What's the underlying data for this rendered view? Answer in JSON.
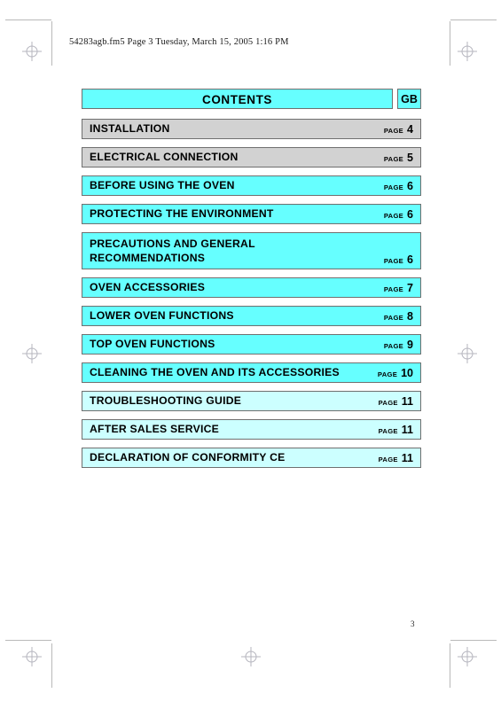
{
  "document": {
    "running_header": "54283agb.fm5  Page 3  Tuesday, March 15, 2005  1:16 PM",
    "folio": "3"
  },
  "contents": {
    "title": "CONTENTS",
    "language_code": "GB",
    "page_word": "PAGE",
    "rows": [
      {
        "label": "INSTALLATION",
        "page": "4",
        "fill": "fill-gray",
        "lines": 1
      },
      {
        "label": "ELECTRICAL CONNECTION",
        "page": "5",
        "fill": "fill-gray",
        "lines": 1
      },
      {
        "label": "BEFORE USING THE OVEN",
        "page": "6",
        "fill": "fill-cyan",
        "lines": 1
      },
      {
        "label": "PROTECTING THE ENVIRONMENT",
        "page": "6",
        "fill": "fill-cyan",
        "lines": 1
      },
      {
        "label": "PRECAUTIONS AND GENERAL\nRECOMMENDATIONS",
        "page": "6",
        "fill": "fill-cyan",
        "lines": 2
      },
      {
        "label": "OVEN ACCESSORIES",
        "page": "7",
        "fill": "fill-cyan",
        "lines": 1
      },
      {
        "label": "LOWER OVEN FUNCTIONS",
        "page": "8",
        "fill": "fill-cyan",
        "lines": 1
      },
      {
        "label": "TOP OVEN FUNCTIONS",
        "page": "9",
        "fill": "fill-cyan",
        "lines": 1
      },
      {
        "label": "CLEANING THE OVEN AND ITS ACCESSORIES",
        "page": "10",
        "fill": "fill-cyan",
        "lines": 1
      },
      {
        "label": "TROUBLESHOOTING GUIDE",
        "page": "11",
        "fill": "fill-pale",
        "lines": 1
      },
      {
        "label": "AFTER SALES SERVICE",
        "page": "11",
        "fill": "fill-pale",
        "lines": 1
      },
      {
        "label": "DECLARATION OF CONFORMITY CE",
        "page": "11",
        "fill": "fill-pale",
        "lines": 1
      }
    ]
  },
  "colors": {
    "cyan": "#66FFFF",
    "pale_cyan": "#CCFFFF",
    "gray": "#D2D2D2",
    "border": "#6F6F6F"
  }
}
